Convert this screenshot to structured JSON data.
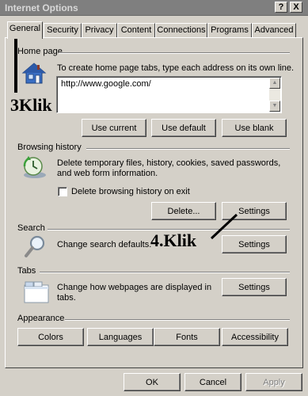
{
  "window": {
    "title": "Internet Options",
    "help_btn": "?",
    "close_btn": "X"
  },
  "tabs": [
    {
      "label": "General"
    },
    {
      "label": "Security"
    },
    {
      "label": "Privacy"
    },
    {
      "label": "Content"
    },
    {
      "label": "Connections"
    },
    {
      "label": "Programs"
    },
    {
      "label": "Advanced"
    }
  ],
  "home_page": {
    "label": "Home page",
    "description": "To create home page tabs, type each address on its own line.",
    "url": "http://www.google.com/",
    "use_current": "Use current",
    "use_default": "Use default",
    "use_blank": "Use blank"
  },
  "browsing_history": {
    "label": "Browsing history",
    "description": "Delete temporary files, history, cookies, saved passwords, and web form information.",
    "checkbox_label": "Delete browsing history on exit",
    "delete_btn": "Delete...",
    "settings_btn": "Settings"
  },
  "search": {
    "label": "Search",
    "description": "Change search defaults.",
    "settings_btn": "Settings"
  },
  "tabs_section": {
    "label": "Tabs",
    "description": "Change how webpages are displayed in tabs.",
    "settings_btn": "Settings"
  },
  "appearance": {
    "label": "Appearance",
    "colors": "Colors",
    "languages": "Languages",
    "fonts": "Fonts",
    "accessibility": "Accessibility"
  },
  "footer": {
    "ok": "OK",
    "cancel": "Cancel",
    "apply": "Apply"
  },
  "annotations": {
    "step3": "3Klik",
    "step4": "4.Klik"
  }
}
